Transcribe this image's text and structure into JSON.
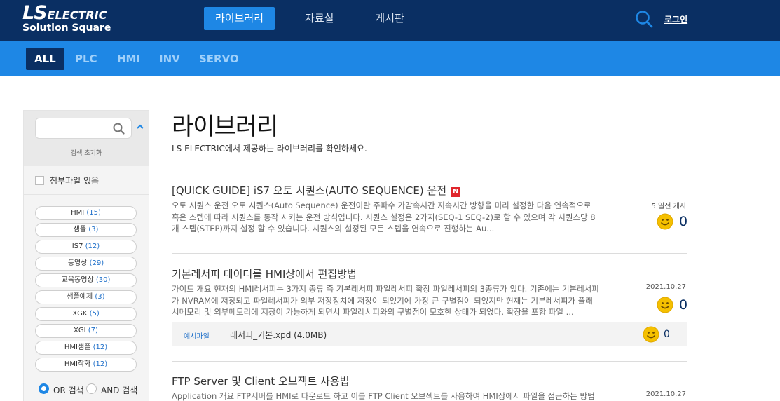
{
  "header": {
    "logo_ls": "LS",
    "logo_electric": "ELECTRIC",
    "logo_sub": "Solution Square",
    "nav": [
      {
        "label": "라이브러리",
        "active": true
      },
      {
        "label": "자료실",
        "active": false
      },
      {
        "label": "게시판",
        "active": false
      }
    ],
    "search_icon": "search-icon",
    "login_label": "로그인",
    "colors": {
      "navy": "#0a2f63",
      "blue": "#1e87e5"
    }
  },
  "categories": [
    {
      "label": "ALL",
      "active": true
    },
    {
      "label": "PLC",
      "active": false
    },
    {
      "label": "HMI",
      "active": false
    },
    {
      "label": "INV",
      "active": false
    },
    {
      "label": "SERVO",
      "active": false
    }
  ],
  "sidebar": {
    "search_placeholder": "",
    "reset_label": "검색 초기화",
    "attach_filter_label": "첨부파일 있음",
    "tags": [
      {
        "name": "HMI",
        "count": "(15)"
      },
      {
        "name": "샘플",
        "count": "(3)"
      },
      {
        "name": "IS7",
        "count": "(12)"
      },
      {
        "name": "동영상",
        "count": "(29)"
      },
      {
        "name": "교육동영상",
        "count": "(30)"
      },
      {
        "name": "샘플예제",
        "count": "(3)"
      },
      {
        "name": "XGK",
        "count": "(5)"
      },
      {
        "name": "XGI",
        "count": "(7)"
      },
      {
        "name": "HMI샘플",
        "count": "(12)"
      },
      {
        "name": "HMI작화",
        "count": "(12)"
      }
    ],
    "search_modes": [
      {
        "label": "OR 검색",
        "selected": true
      },
      {
        "label": "AND 검색",
        "selected": false
      }
    ]
  },
  "main": {
    "title": "라이브러리",
    "description": "LS ELECTRIC에서 제공하는 라이브러리를 확인하세요.",
    "posts": [
      {
        "title": "[QUICK GUIDE] iS7 오토 시퀀스(AUTO SEQUENCE) 운전",
        "is_new": true,
        "new_badge": "N",
        "body": "오토 시퀀스 운전 오토 시퀀스(Auto Sequence) 운전이란 주파수 가감속시간 지속시간 방향을 미리 설정한 다음 연속적으로 혹은 스텝에 따라 시퀀스를 동작 시키는 운전 방식입니다. 시퀀스 설정은 2가지(SEQ-1 SEQ-2)로 할 수 있으며 각 시퀀스당 8개 스텝(STEP)까지 설정 할 수 있습니다. 시퀀스의 설정된 모든 스텝을 연속으로 진행하는 Au...",
        "date": "5 일전 게시",
        "likes": "0"
      },
      {
        "title": "기본레서피 데이터를 HMI상에서 편집방법",
        "is_new": false,
        "body": "가이드 개요 현재의 HMI레서피는 3가지 종류 즉 기본레서피 파일레서피 확장 파일레서피의 3종류가 있다. 기존에는 기본레서피가 NVRAM에 저장되고 파일레서피가 외부 저장장치에 저장이 되었기에 가장 큰 구별점이 되었지만 현재는 기본레서피가 플래시메모리 및 외부메모리에 저장이 가능하게 되면서 파일레서피와의 구별점이 모호한 상태가 되었다. 확장을 포함 파일 ...",
        "date": "2021.10.27",
        "likes": "0",
        "attachment": {
          "kind": "예시파일",
          "file": "레서피_기본.xpd (4.0MB)",
          "likes": "0"
        }
      },
      {
        "title": "FTP Server 및 Client 오브젝트 사용법",
        "is_new": false,
        "body": "Application 개요 FTP서버를 HMI로 다운로드 하고 이를 FTP Client 오브젝트를 사용하여 HMI상에서 파일을 접근하는 방법을",
        "date": "2021.10.27"
      }
    ]
  }
}
